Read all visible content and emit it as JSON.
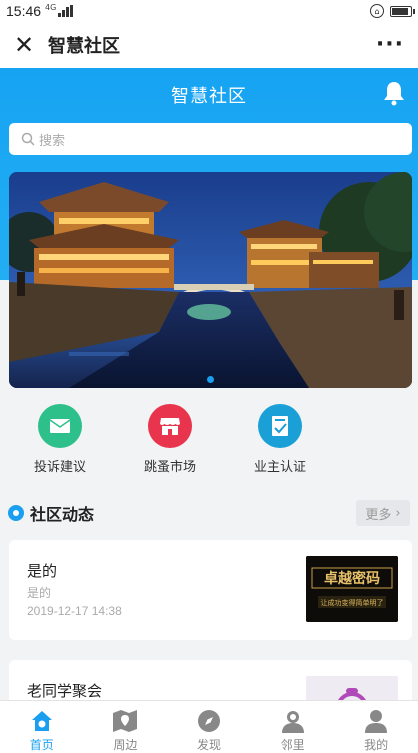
{
  "status_bar": {
    "time": "15:46",
    "network": "4G"
  },
  "title_bar": {
    "title": "智慧社区",
    "close_icon": "close-icon",
    "more_icon": "more-dots-icon"
  },
  "header": {
    "heading": "智慧社区",
    "notify_icon": "bell-icon",
    "accent_color": "#1a9ff0"
  },
  "search": {
    "placeholder": "搜索"
  },
  "banner": {
    "slides": 1,
    "active_slide": 1
  },
  "quick_actions": [
    {
      "label": "投诉建议",
      "icon": "mail-icon",
      "color": "#2ec08a"
    },
    {
      "label": "跳蚤市场",
      "icon": "shop-icon",
      "color": "#e8344d"
    },
    {
      "label": "业主认证",
      "icon": "certificate-icon",
      "color": "#1a9fd6"
    }
  ],
  "section": {
    "title": "社区动态",
    "more_label": "更多"
  },
  "feed": [
    {
      "title": "是的",
      "summary": "是的",
      "date": "2019-12-17 14:38",
      "thumb_text": "卓越密码",
      "thumb_sub": "让成功变得简单明了"
    },
    {
      "title": "老同学聚会"
    }
  ],
  "tabs": [
    {
      "label": "首页",
      "icon": "home-icon",
      "active": true
    },
    {
      "label": "周边",
      "icon": "map-icon",
      "active": false
    },
    {
      "label": "发现",
      "icon": "compass-icon",
      "active": false
    },
    {
      "label": "邻里",
      "icon": "neighbors-icon",
      "active": false
    },
    {
      "label": "我的",
      "icon": "user-icon",
      "active": false
    }
  ]
}
